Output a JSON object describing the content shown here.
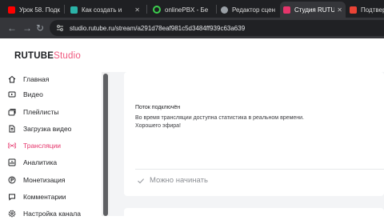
{
  "browser": {
    "tabs": [
      {
        "title": "Урок 58. Подк",
        "icon": "youtube-icon",
        "color": "#ff0000",
        "active": false
      },
      {
        "title": "Как создать и",
        "icon": "site-icon",
        "color": "#2bb3a8",
        "active": false
      },
      {
        "title": "onlinePBX - Бе",
        "icon": "onlinepbx-icon",
        "color": "#3ccf4e",
        "active": false
      },
      {
        "title": "Редактор сцен",
        "icon": "globe-icon",
        "color": "#9aa0a6",
        "active": false
      },
      {
        "title": "Студия RUTUBE",
        "icon": "rutube-studio-icon",
        "color": "#e5356b",
        "active": true
      },
      {
        "title": "Подтвержд",
        "icon": "gmail-icon",
        "color": "#ea4335",
        "active": false
      }
    ],
    "url": "studio.rutube.ru/stream/a291d78eaf981c5d3484ff939c63a639"
  },
  "header": {
    "logo_main": "RUTUBE",
    "logo_studio": "Studio",
    "accent": "#f0567d"
  },
  "sidebar": {
    "items": [
      {
        "label": "Главная",
        "icon": "home-icon",
        "active": false
      },
      {
        "label": "Видео",
        "icon": "video-icon",
        "active": false
      },
      {
        "label": "Плейлисты",
        "icon": "playlist-icon",
        "active": false
      },
      {
        "label": "Загрузка видео",
        "icon": "upload-icon",
        "active": false
      },
      {
        "label": "Трансляции",
        "icon": "broadcast-icon",
        "active": true
      },
      {
        "label": "Аналитика",
        "icon": "analytics-icon",
        "active": false
      },
      {
        "label": "Монетизация",
        "icon": "monetization-icon",
        "active": false
      },
      {
        "label": "Комментарии",
        "icon": "comments-icon",
        "active": false
      },
      {
        "label": "Настройка канала",
        "icon": "settings-icon",
        "active": false
      }
    ]
  },
  "stream": {
    "status_title": "Поток подключён",
    "status_desc_line1": "Во время трансляции доступна статистика в реальном времени.",
    "status_desc_line2": "Хорошего эфира!",
    "ready_label": "Можно начинать"
  }
}
